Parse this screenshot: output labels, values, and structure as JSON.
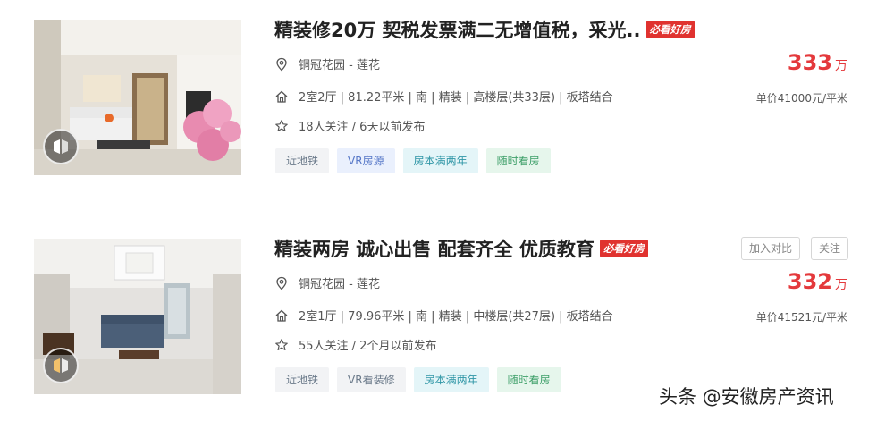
{
  "listings": [
    {
      "title": "精装修20万 契税发票满二无增值税，采光..",
      "must_see_tag": "必看好房",
      "location": "铜冠花园 - 莲花",
      "house_info": "2室2厅 | 81.22平米 | 南 | 精装 | 高楼层(共33层) | 板塔结合",
      "follow_info": "18人关注 / 6天以前发布",
      "tags": [
        "近地铁",
        "VR房源",
        "房本满两年",
        "随时看房"
      ],
      "total_price": "333",
      "price_unit": "万",
      "unit_price": "单价41000元/平米"
    },
    {
      "title": "精装两房 诚心出售 配套齐全 优质教育",
      "must_see_tag": "必看好房",
      "location": "铜冠花园 - 莲花",
      "house_info": "2室1厅 | 79.96平米 | 南 | 精装 | 中楼层(共27层) | 板塔结合",
      "follow_info": "55人关注 / 2个月以前发布",
      "tags": [
        "近地铁",
        "VR看装修",
        "房本满两年",
        "随时看房"
      ],
      "total_price": "332",
      "price_unit": "万",
      "unit_price": "单价41521元/平米",
      "compare_button": "加入对比",
      "follow_button": "关注"
    }
  ],
  "watermark": "头条 @安徽房产资讯",
  "colors": {
    "price": "#e4393c",
    "must_see_tag_bg": "#e0322f"
  }
}
